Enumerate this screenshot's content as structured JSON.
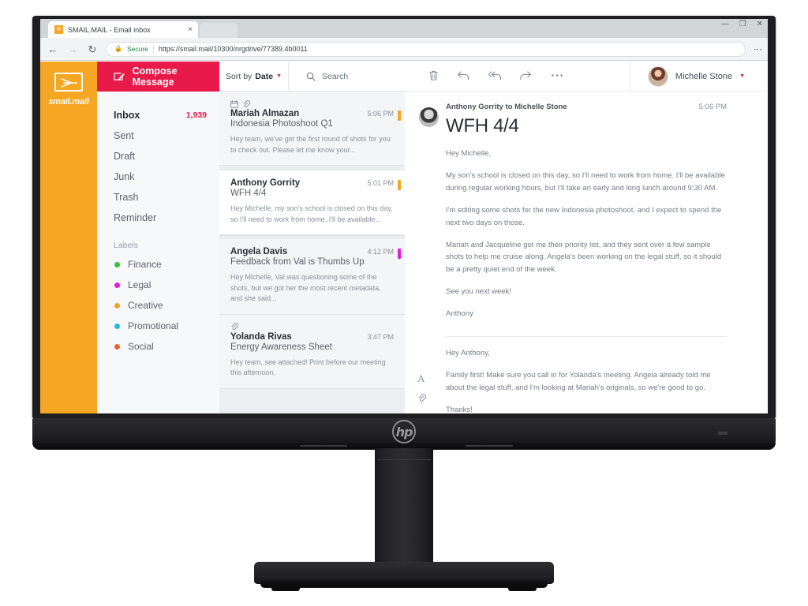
{
  "browser": {
    "tab_title": "SMAIL.MAIL - Email inbox",
    "tab_close_glyph": "×",
    "favicon_glyph": "✉",
    "back_glyph": "←",
    "forward_glyph": "→",
    "reload_glyph": "↻",
    "lock_glyph": "🔒",
    "secure_label": "Secure",
    "url": "https://smail.mail/10300/nrgdrive/77389.4b0011",
    "url_scheme": "https://",
    "url_rest": "smail.mail/10300/nrgdrive/77389.4b0011",
    "menu_glyph": "⋮",
    "minimize_glyph": "—",
    "maximize_glyph": "❐",
    "close_glyph": "✕"
  },
  "brand": {
    "name": "smail.mail",
    "color": "#f5a623"
  },
  "compose": {
    "label": "Compose Message",
    "icon": "compose-pencil-icon",
    "color": "#e81a4a"
  },
  "folders": [
    {
      "label": "Inbox",
      "count": "1,939",
      "active": true
    },
    {
      "label": "Sent",
      "count": "",
      "active": false
    },
    {
      "label": "Draft",
      "count": "",
      "active": false
    },
    {
      "label": "Junk",
      "count": "",
      "active": false
    },
    {
      "label": "Trash",
      "count": "",
      "active": false
    },
    {
      "label": "Reminder",
      "count": "",
      "active": false
    }
  ],
  "labels_header": "Labels",
  "labels": [
    {
      "label": "Finance",
      "color": "#3cc13c"
    },
    {
      "label": "Legal",
      "color": "#e51ce0"
    },
    {
      "label": "Creative",
      "color": "#f0a22e"
    },
    {
      "label": "Promotional",
      "color": "#27b5e8"
    },
    {
      "label": "Social",
      "color": "#e8622a"
    }
  ],
  "list_header": {
    "sort_prefix": "Sort by ",
    "sort_value": "Date",
    "sort_caret": "▼",
    "search_placeholder": "Search",
    "search_icon": "search-magnifier-icon"
  },
  "mail_list": [
    {
      "sender": "Mariah Almazan",
      "subject": "Indonesia Photoshoot Q1",
      "time": "5:06 PM",
      "preview": "Hey team, we've got the first round of shots for you to check out. Please let me know your...",
      "stripe_color": "#f5a623",
      "has_calendar_icon": true,
      "has_attachment_icon": true,
      "selected": false
    },
    {
      "sender": "Anthony Gorrity",
      "subject": "WFH 4/4",
      "time": "5:01 PM",
      "preview": "Hey Michelle, my son's school is closed on this day, so I'll need to work from home. I'll be available...",
      "stripe_color": "#f5a623",
      "has_calendar_icon": false,
      "has_attachment_icon": false,
      "selected": true
    },
    {
      "sender": "Angela Davis",
      "subject": "Feedback from Val is Thumbs Up",
      "time": "4:12 PM",
      "preview": "Hey Michelle, Val was questioning some of the shots, but we got her the most recent metadata, and she said...",
      "stripe_color": "#e51ce0",
      "has_calendar_icon": false,
      "has_attachment_icon": false,
      "selected": false
    },
    {
      "sender": "Yolanda Rivas",
      "subject": "Energy Awareness Sheet",
      "time": "3:47 PM",
      "preview": "Hey team, see attached! Print before our meeting this afternoon.",
      "stripe_color": "",
      "has_calendar_icon": false,
      "has_attachment_icon": true,
      "selected": false
    }
  ],
  "actions": [
    {
      "name": "delete-icon",
      "glyph": "🗑"
    },
    {
      "name": "reply-icon",
      "glyph": "↩"
    },
    {
      "name": "reply-all-icon",
      "glyph": "↭"
    },
    {
      "name": "forward-icon",
      "glyph": "↪"
    },
    {
      "name": "more-options-icon",
      "glyph": "•••"
    }
  ],
  "user": {
    "name": "Michelle Stone",
    "caret": "▼"
  },
  "message": {
    "from_line": "Anthony Gorrity to Michelle Stone",
    "time": "5:06 PM",
    "subject": "WFH 4/4",
    "paragraphs": [
      "Hey Michelle,",
      "My son's school is closed on this day, so I'll need to work from home. I'll be available during regular working hours, but I'll take an early and long lunch around 9:30 AM.",
      "I'm editing some shots for the new Indonesia photoshoot, and I expect to spend the next two days on those.",
      "Mariah and Jacqueline got me their priority list, and they sent over a few sample shots to help me cruise along. Angela's been working on the legal stuff, so it should be a pretty quiet end of the week.",
      "See you next week!",
      "Anthony"
    ]
  },
  "quoted_message": {
    "paragraphs": [
      "Hey Anthony,",
      "Family first! Make sure you call in for Yolanda's meeting. Angela already told me about the legal stuff, and I'm looking at Mariah's originals, so we're good to go.",
      "Thanks!"
    ],
    "icons": [
      {
        "name": "text-format-icon",
        "glyph": "A"
      },
      {
        "name": "attachment-icon",
        "glyph": "🔗"
      }
    ]
  },
  "monitor": {
    "brand_glyph": "hp"
  }
}
